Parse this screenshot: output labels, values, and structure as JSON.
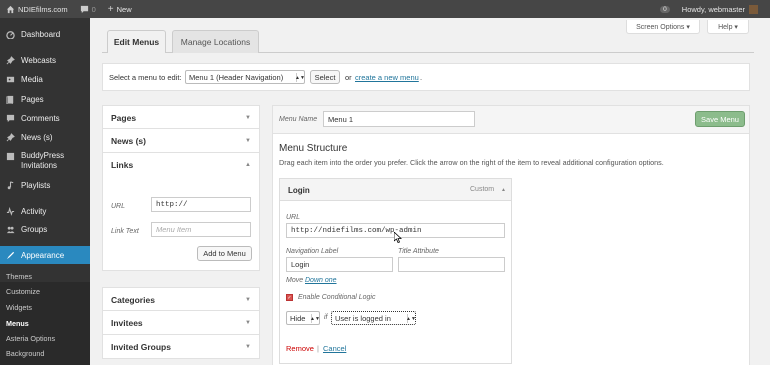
{
  "adminbar": {
    "site_name": "NDIEfilms.com",
    "comments_count": "0",
    "new_label": "New",
    "notif_count": "0",
    "howdy": "Howdy, webmaster"
  },
  "sidebar": {
    "items": [
      {
        "label": "Dashboard",
        "icon": "dashboard-icon"
      },
      {
        "label": "Webcasts",
        "icon": "pin-icon"
      },
      {
        "label": "Media",
        "icon": "media-icon"
      },
      {
        "label": "Pages",
        "icon": "pages-icon"
      },
      {
        "label": "Comments",
        "icon": "comments-icon"
      },
      {
        "label": "News (s)",
        "icon": "pin-icon"
      },
      {
        "label": "BuddyPress Invitations",
        "icon": "buddypress-icon"
      },
      {
        "label": "Playlists",
        "icon": "playlist-icon"
      },
      {
        "label": "Activity",
        "icon": "activity-icon"
      },
      {
        "label": "Groups",
        "icon": "groups-icon"
      },
      {
        "label": "Appearance",
        "icon": "appearance-icon"
      }
    ],
    "submenu": [
      "Themes",
      "Customize",
      "Widgets",
      "Menus",
      "Asteria Options",
      "Background"
    ]
  },
  "header": {
    "screen_options": "Screen Options ▾",
    "help": "Help ▾",
    "tabs": [
      "Edit Menus",
      "Manage Locations"
    ]
  },
  "select_bar": {
    "label": "Select a menu to edit:",
    "selected": "Menu 1 (Header Navigation)",
    "select_btn": "Select",
    "or_text": "or",
    "create_link": "create a new menu",
    "period": "."
  },
  "left_panel": {
    "sections": [
      "Pages",
      "News (s)",
      "Links",
      "Categories",
      "Invitees",
      "Invited Groups"
    ],
    "links": {
      "url_label": "URL",
      "url_value": "http://",
      "link_text_label": "Link Text",
      "link_text_placeholder": "Menu Item",
      "add_btn": "Add to Menu"
    }
  },
  "menu_editor": {
    "menu_name_label": "Menu Name",
    "menu_name_value": "Menu 1",
    "save_btn": "Save Menu",
    "structure_title": "Menu Structure",
    "structure_desc": "Drag each item into the order you prefer. Click the arrow on the right of the item to reveal additional configuration options.",
    "item": {
      "title": "Login",
      "type": "Custom",
      "url_label": "URL",
      "url_value": "http://ndiefilms.com/wp-admin",
      "nav_label": "Navigation Label",
      "nav_value": "Login",
      "title_attr_label": "Title Attribute",
      "move_text": "Move",
      "move_link": "Down one",
      "cond_logic": "Enable Conditional Logic",
      "hide_value": "Hide",
      "if_text": "if",
      "condition_value": "User is logged in",
      "remove": "Remove",
      "sep": "|",
      "cancel": "Cancel"
    }
  }
}
